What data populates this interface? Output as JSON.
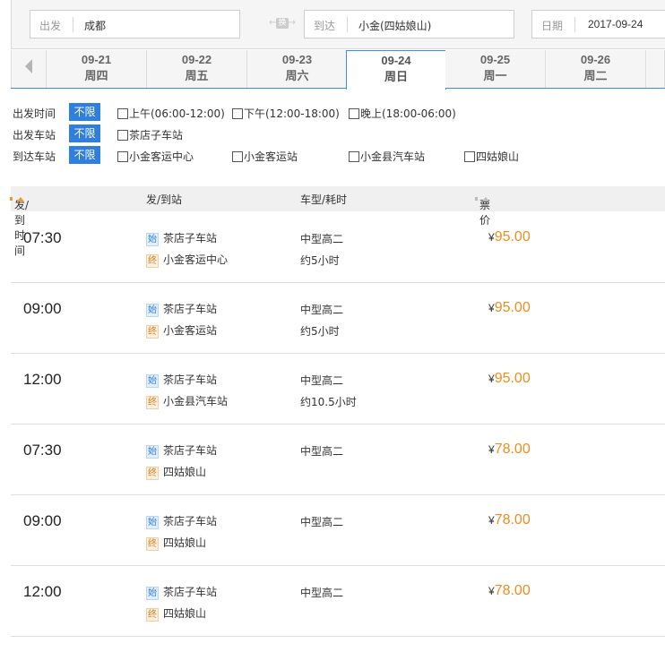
{
  "search": {
    "from_label": "出发",
    "from_value": "成都",
    "swap_label": "换",
    "to_label": "到达",
    "to_value": "小金(四姑娘山)",
    "date_label": "日期",
    "date_value": "2017-09-24"
  },
  "dates": [
    {
      "date": "09-21",
      "weekday": "周四"
    },
    {
      "date": "09-22",
      "weekday": "周五"
    },
    {
      "date": "09-23",
      "weekday": "周六"
    },
    {
      "date": "09-24",
      "weekday": "周日"
    },
    {
      "date": "09-25",
      "weekday": "周一"
    },
    {
      "date": "09-26",
      "weekday": "周二"
    }
  ],
  "filters": {
    "unlimited_label": "不限",
    "departure_time": {
      "label": "出发时间",
      "options": [
        "上午(06:00-12:00)",
        "下午(12:00-18:00)",
        "晚上(18:00-06:00)"
      ]
    },
    "departure_station": {
      "label": "出发车站",
      "options": [
        "茶店子车站"
      ]
    },
    "arrival_station": {
      "label": "到达车站",
      "options": [
        "小金客运中心",
        "小金客运站",
        "小金县汽车站",
        "四姑娘山"
      ]
    }
  },
  "table": {
    "headers": {
      "time": "发/到时间",
      "stations": "发/到站",
      "bus": "车型/耗时",
      "price": "票价"
    },
    "start_tag": "始",
    "end_tag": "终",
    "currency": "¥",
    "rows": [
      {
        "time": "07:30",
        "from": "茶店子车站",
        "to": "小金客运中心",
        "bus_type": "中型高二",
        "duration": "约5小时",
        "price": "95.00"
      },
      {
        "time": "09:00",
        "from": "茶店子车站",
        "to": "小金客运站",
        "bus_type": "中型高二",
        "duration": "约5小时",
        "price": "95.00"
      },
      {
        "time": "12:00",
        "from": "茶店子车站",
        "to": "小金县汽车站",
        "bus_type": "中型高二",
        "duration": "约10.5小时",
        "price": "95.00"
      },
      {
        "time": "07:30",
        "from": "茶店子车站",
        "to": "四姑娘山",
        "bus_type": "中型高二",
        "duration": "",
        "price": "78.00"
      },
      {
        "time": "09:00",
        "from": "茶店子车站",
        "to": "四姑娘山",
        "bus_type": "中型高二",
        "duration": "",
        "price": "78.00"
      },
      {
        "time": "12:00",
        "from": "茶店子车站",
        "to": "四姑娘山",
        "bus_type": "中型高二",
        "duration": "",
        "price": "78.00"
      }
    ]
  },
  "colors": {
    "accent_blue": "#2f7fe0",
    "price_orange": "#f08c1c",
    "sort_active": "#f39a1e"
  }
}
